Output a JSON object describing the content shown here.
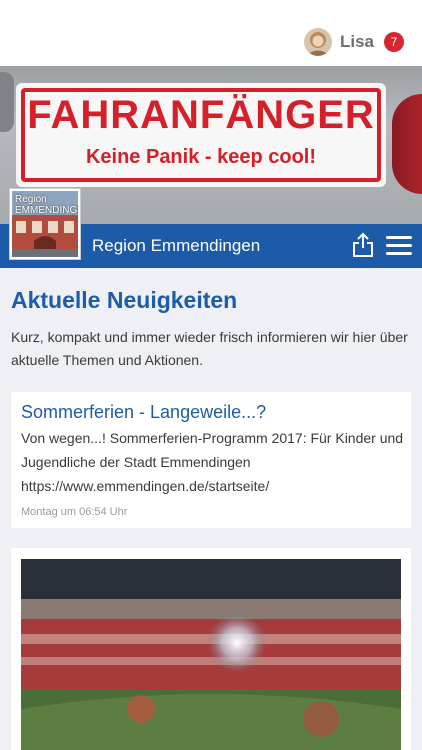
{
  "header": {
    "user_name": "Lisa",
    "notification_count": "7"
  },
  "cover": {
    "sticker_title": "FAHRANFÄNGER",
    "sticker_subtitle": "Keine Panik - keep cool!"
  },
  "group": {
    "thumbnail_text_line1": "Region",
    "thumbnail_text_line2": "EMMENDINGEN",
    "title": "Region Emmendingen"
  },
  "section": {
    "title": "Aktuelle Neuigkeiten",
    "description": "Kurz, kompakt und immer wieder frisch informieren wir hier über aktuelle Themen und Aktionen."
  },
  "posts": [
    {
      "title": "Sommerferien - Langeweile...?",
      "body": "Von wegen...! Sommerferien-Programm 2017: Für Kinder und Jugendliche der Stadt Emmendingen https://www.emmendingen.de/startseite/",
      "time": "Montag um 06:54 Uhr"
    }
  ],
  "colors": {
    "brand_blue": "#1b5ba8",
    "badge_red": "#d6262f",
    "sticker_red": "#d5202a"
  },
  "icons": {
    "share": "share-icon",
    "menu": "hamburger-menu-icon"
  }
}
